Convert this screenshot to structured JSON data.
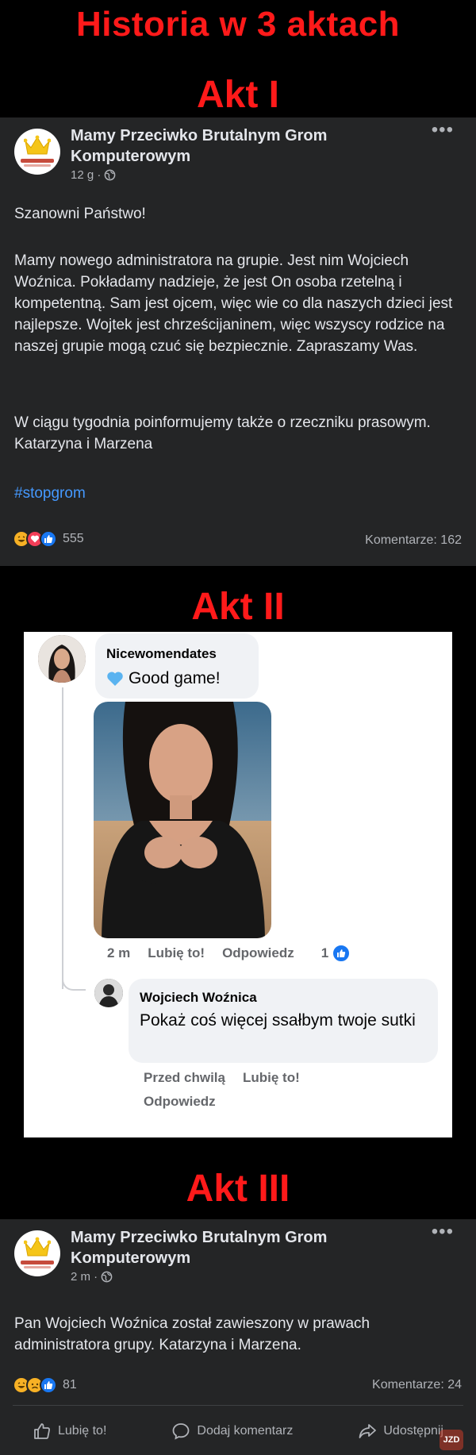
{
  "page": {
    "main_title": "Historia w 3 aktach",
    "act1": "Akt I",
    "act2": "Akt II",
    "act3": "Akt III"
  },
  "post1": {
    "group_name": "Mamy Przeciwko Brutalnym Grom Komputerowym",
    "time": "12 g ·",
    "greeting": "Szanowni Państwo!",
    "paragraph1": "Mamy nowego administratora na grupie. Jest nim Wojciech Woźnica. Pokładamy nadzieje, że jest On osoba rzetelną i kompetentną. Sam jest ojcem, więc wie co dla naszych dzieci jest najlepsze. Wojtek jest chrześcijaninem, więc wszyscy rodzice na naszej grupie mogą czuć się bezpiecznie. Zapraszamy Was.",
    "paragraph2": "W ciągu tygodnia poinformujemy także o rzeczniku prasowym. Katarzyna i Marzena",
    "hashtag": "#stopgrom",
    "reactions_count": "555",
    "comments": "Komentarze: 162"
  },
  "comment1": {
    "author": "Nicewomendates",
    "text": "Good game!",
    "time": "2 m",
    "like": "Lubię to!",
    "reply": "Odpowiedz",
    "like_count": "1"
  },
  "comment2": {
    "author": "Wojciech Woźnica",
    "text": "Pokaż coś więcej ssałbym twoje sutki",
    "time": "Przed chwilą",
    "like": "Lubię to!",
    "reply": "Odpowiedz"
  },
  "post3": {
    "group_name": "Mamy Przeciwko Brutalnym Grom Komputerowym",
    "time": "2 m ·",
    "text": "Pan Wojciech Woźnica został zawieszony w prawach administratora grupy. Katarzyna i Marzena.",
    "reactions_count": "81",
    "comments": "Komentarze: 24",
    "actions": {
      "like": "Lubię to!",
      "comment": "Dodaj komentarz",
      "share": "Udostępnij"
    }
  },
  "watermark": "JZD",
  "colors": {
    "title_red": "#ff1a1a",
    "post_bg": "#242526",
    "link_blue": "#4599ff",
    "like_blue": "#1877f2"
  },
  "icons": [
    "crown-icon",
    "globe-icon",
    "more-icon",
    "haha-icon",
    "love-icon",
    "like-icon",
    "sad-icon",
    "blue-heart-icon",
    "comment-icon",
    "share-icon"
  ]
}
